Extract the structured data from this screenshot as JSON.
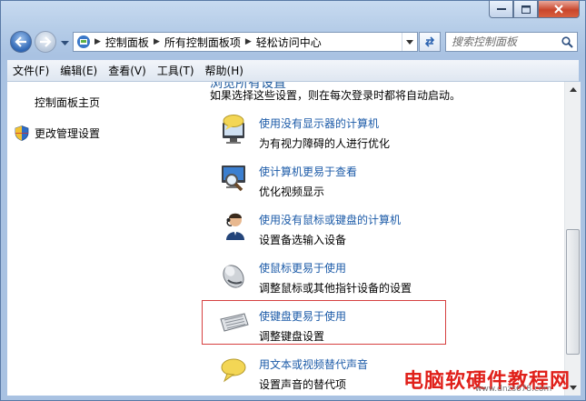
{
  "window": {
    "buttons": [
      "minimize",
      "maximize",
      "close"
    ]
  },
  "nav": {
    "breadcrumbs": [
      "控制面板",
      "所有控制面板项",
      "轻松访问中心"
    ],
    "search_placeholder": "搜索控制面板"
  },
  "menu": [
    "文件(F)",
    "编辑(E)",
    "查看(V)",
    "工具(T)",
    "帮助(H)"
  ],
  "sidebar": {
    "home": "控制面板主页",
    "manage": "更改管理设置"
  },
  "content": {
    "partial_heading": "浏览所有设置",
    "intro": "如果选择这些设置，则在每次登录时都将自动启动。",
    "tasks": [
      {
        "title": "使用没有显示器的计算机",
        "desc": "为有视力障碍的人进行优化",
        "icon": "speech-monitor-icon"
      },
      {
        "title": "使计算机更易于查看",
        "desc": "优化视频显示",
        "icon": "magnifier-monitor-icon"
      },
      {
        "title": "使用没有鼠标或键盘的计算机",
        "desc": "设置备选输入设备",
        "icon": "user-headset-icon"
      },
      {
        "title": "使鼠标更易于使用",
        "desc": "调整鼠标或其他指针设备的设置",
        "icon": "mouse-icon"
      },
      {
        "title": "使键盘更易于使用",
        "desc": "调整键盘设置",
        "icon": "keyboard-icon"
      },
      {
        "title": "用文本或视频替代声音",
        "desc": "设置声音的替代项",
        "icon": "speech-bubble-icon"
      }
    ]
  },
  "watermark": {
    "text": "电脑软硬件教程网",
    "url": "www.dnzs678.com"
  }
}
